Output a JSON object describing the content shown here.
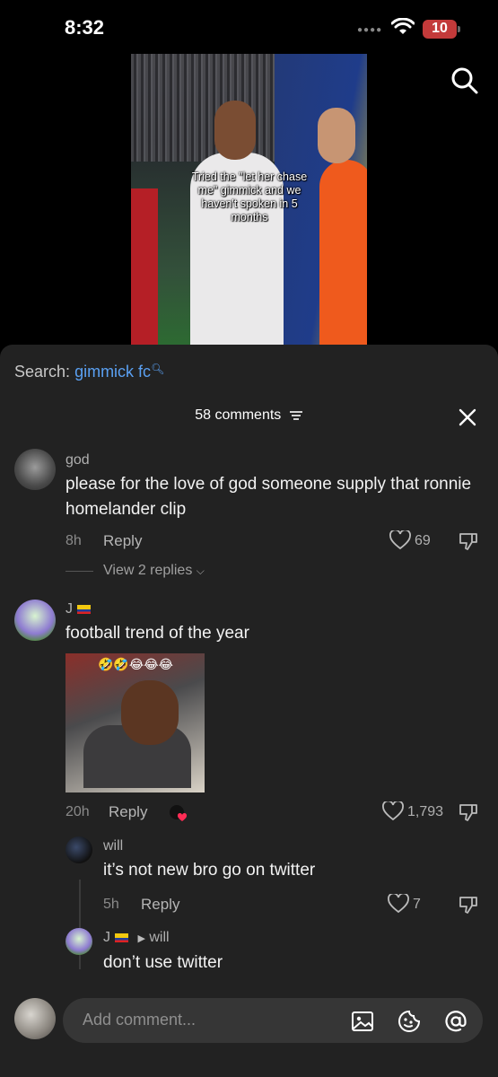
{
  "status_bar": {
    "time": "8:32",
    "battery": "10"
  },
  "video": {
    "caption": "Tried the \"let her chase me\" gimmick and we haven't spoken in 5 months"
  },
  "search": {
    "label": "Search:",
    "query": "gimmick fc",
    "icon": "search-icon"
  },
  "comments_header": {
    "count_label": "58 comments"
  },
  "comments": [
    {
      "username": "god",
      "text": "please for the love of god someone supply that ronnie homelander clip",
      "time": "8h",
      "reply_label": "Reply",
      "likes": "69",
      "view_replies": "View 2 replies"
    },
    {
      "username": "J",
      "text": "football trend of the year",
      "time": "20h",
      "reply_label": "Reply",
      "likes": "1,793",
      "meme_emojis": "🤣🤣😂😂😂"
    }
  ],
  "replies": [
    {
      "username": "will",
      "text": "it’s not new bro go on twitter",
      "time": "5h",
      "reply_label": "Reply",
      "likes": "7"
    },
    {
      "username": "J",
      "reply_to": "will",
      "text": "don’t use twitter"
    }
  ],
  "composer": {
    "placeholder": "Add comment..."
  },
  "colors": {
    "sheet_bg": "#222222",
    "link_blue": "#5aa0f2",
    "battery_red": "#c33a3a"
  }
}
